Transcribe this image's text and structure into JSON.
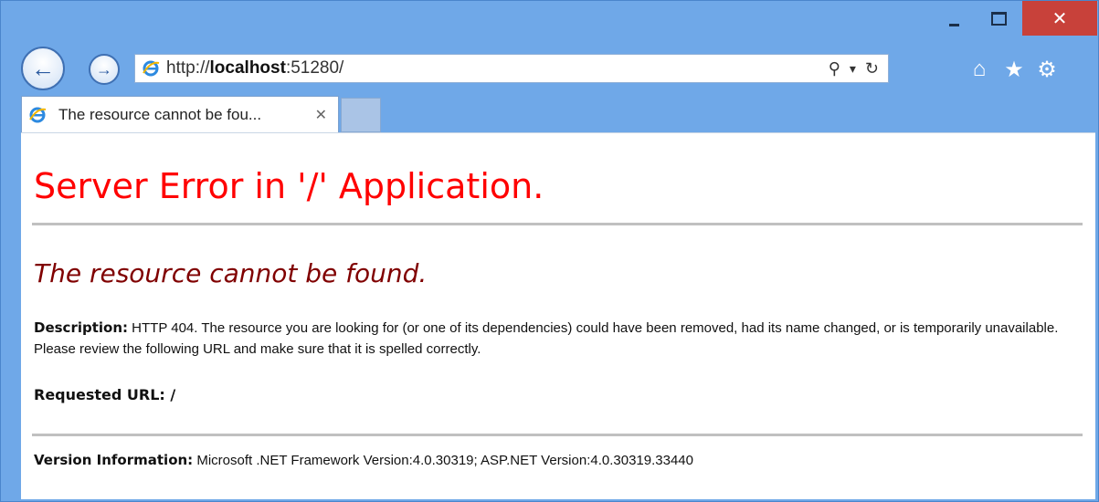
{
  "window": {
    "close_glyph": "✕"
  },
  "navigation": {
    "back_glyph": "←",
    "forward_glyph": "→",
    "url_prefix": "http://",
    "url_host": "localhost",
    "url_suffix": ":51280/",
    "search_glyph": "⚲",
    "dropdown_glyph": "▾",
    "refresh_glyph": "↻",
    "home_glyph": "⌂",
    "favorites_glyph": "★",
    "tools_glyph": "⚙",
    "icons": [
      "back-icon",
      "forward-icon",
      "ie-icon",
      "search-icon",
      "chevron-down-icon",
      "refresh-icon",
      "home-icon",
      "star-icon",
      "gear-icon"
    ]
  },
  "tab": {
    "title": "The resource cannot be fou...",
    "close_glyph": "✕"
  },
  "page": {
    "title": "Server Error in '/' Application.",
    "subtitle": "The resource cannot be found.",
    "description_label": "Description:",
    "description_text": " HTTP 404. The resource you are looking for (or one of its dependencies) could have been removed, had its name changed, or is temporarily unavailable.  Please review the following URL and make sure that it is spelled correctly.",
    "requested_url_label": "Requested URL:",
    "requested_url_value": " /",
    "version_label": "Version Information:",
    "version_text": " Microsoft .NET Framework Version:4.0.30319; ASP.NET Version:4.0.30319.33440"
  },
  "colors": {
    "chrome": "#6fa8e8",
    "close": "#c8413a",
    "title_red": "#ff0000",
    "subtitle_maroon": "#800000",
    "rule": "#c0c0c0"
  }
}
